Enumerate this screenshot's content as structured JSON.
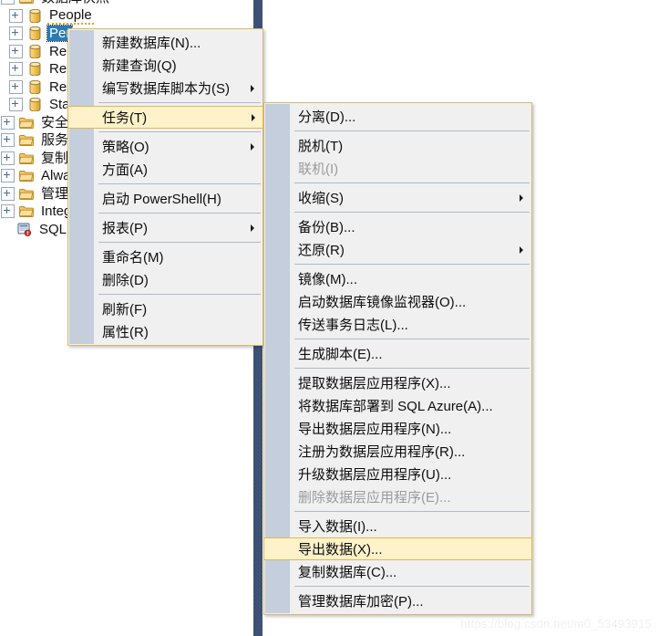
{
  "colors": {
    "menu_bg": "#f0f0f0",
    "menu_border": "#d7b96a",
    "menu_gutter": "#c4cedc",
    "highlight_bg": "#fdf2ca",
    "highlight_border": "#e3b84b",
    "tree_selected_bg": "#2a7ab9",
    "splitter": "#3b4f72",
    "separator": "#b0b9c6",
    "disabled_text": "#9b9b9b",
    "folder_icon": "#f0c05a",
    "database_icon": "#e8b54d"
  },
  "tree": {
    "name": "object-explorer-tree",
    "items": [
      {
        "label": "数据库快照",
        "icon": "folder-icon",
        "expandable": true,
        "indent": 1,
        "clipped_top": true,
        "selected": false
      },
      {
        "label": "People",
        "icon": "database-icon",
        "expandable": true,
        "indent": 2,
        "selected": false,
        "focus_underline": true
      },
      {
        "label": "Per",
        "icon": "database-icon",
        "expandable": true,
        "indent": 2,
        "selected": true
      },
      {
        "label": "Rep",
        "icon": "database-icon",
        "expandable": true,
        "indent": 2,
        "selected": false
      },
      {
        "label": "Rep",
        "icon": "database-icon",
        "expandable": true,
        "indent": 2,
        "selected": false
      },
      {
        "label": "Res",
        "icon": "database-icon",
        "expandable": true,
        "indent": 2,
        "selected": false
      },
      {
        "label": "Sta",
        "icon": "database-icon",
        "expandable": true,
        "indent": 2,
        "selected": false
      },
      {
        "label": "安全性",
        "icon": "folder-icon",
        "expandable": true,
        "indent": 1,
        "selected": false
      },
      {
        "label": "服务器",
        "icon": "folder-icon",
        "expandable": true,
        "indent": 1,
        "selected": false
      },
      {
        "label": "复制",
        "icon": "folder-icon",
        "expandable": true,
        "indent": 1,
        "selected": false
      },
      {
        "label": "Alway",
        "icon": "folder-icon",
        "expandable": true,
        "indent": 1,
        "selected": false
      },
      {
        "label": "管理",
        "icon": "folder-icon",
        "expandable": true,
        "indent": 1,
        "selected": false
      },
      {
        "label": "Integr",
        "icon": "folder-icon",
        "expandable": true,
        "indent": 1,
        "selected": false
      },
      {
        "label": "SQL S",
        "icon": "sql-server-agent-error-icon",
        "expandable": false,
        "indent": 1,
        "selected": false
      }
    ]
  },
  "context_menu_primary": {
    "name": "database-context-menu",
    "items": [
      {
        "label": "新建数据库(N)...",
        "type": "item",
        "submenu": false,
        "disabled": false,
        "highlighted": false
      },
      {
        "label": "新建查询(Q)",
        "type": "item",
        "submenu": false,
        "disabled": false,
        "highlighted": false
      },
      {
        "label": "编写数据库脚本为(S)",
        "type": "item",
        "submenu": true,
        "disabled": false,
        "highlighted": false
      },
      {
        "type": "separator"
      },
      {
        "label": "任务(T)",
        "type": "item",
        "submenu": true,
        "disabled": false,
        "highlighted": true
      },
      {
        "type": "separator"
      },
      {
        "label": "策略(O)",
        "type": "item",
        "submenu": true,
        "disabled": false,
        "highlighted": false
      },
      {
        "label": "方面(A)",
        "type": "item",
        "submenu": false,
        "disabled": false,
        "highlighted": false
      },
      {
        "type": "separator"
      },
      {
        "label": "启动 PowerShell(H)",
        "type": "item",
        "submenu": false,
        "disabled": false,
        "highlighted": false
      },
      {
        "type": "separator"
      },
      {
        "label": "报表(P)",
        "type": "item",
        "submenu": true,
        "disabled": false,
        "highlighted": false
      },
      {
        "type": "separator"
      },
      {
        "label": "重命名(M)",
        "type": "item",
        "submenu": false,
        "disabled": false,
        "highlighted": false
      },
      {
        "label": "删除(D)",
        "type": "item",
        "submenu": false,
        "disabled": false,
        "highlighted": false
      },
      {
        "type": "separator"
      },
      {
        "label": "刷新(F)",
        "type": "item",
        "submenu": false,
        "disabled": false,
        "highlighted": false
      },
      {
        "label": "属性(R)",
        "type": "item",
        "submenu": false,
        "disabled": false,
        "highlighted": false
      }
    ]
  },
  "context_menu_tasks": {
    "name": "tasks-submenu",
    "items": [
      {
        "label": "分离(D)...",
        "type": "item",
        "submenu": false,
        "disabled": false,
        "highlighted": false
      },
      {
        "type": "separator"
      },
      {
        "label": "脱机(T)",
        "type": "item",
        "submenu": false,
        "disabled": false,
        "highlighted": false
      },
      {
        "label": "联机(I)",
        "type": "item",
        "submenu": false,
        "disabled": true,
        "highlighted": false
      },
      {
        "type": "separator"
      },
      {
        "label": "收缩(S)",
        "type": "item",
        "submenu": true,
        "disabled": false,
        "highlighted": false
      },
      {
        "type": "separator"
      },
      {
        "label": "备份(B)...",
        "type": "item",
        "submenu": false,
        "disabled": false,
        "highlighted": false
      },
      {
        "label": "还原(R)",
        "type": "item",
        "submenu": true,
        "disabled": false,
        "highlighted": false
      },
      {
        "type": "separator"
      },
      {
        "label": "镜像(M)...",
        "type": "item",
        "submenu": false,
        "disabled": false,
        "highlighted": false
      },
      {
        "label": "启动数据库镜像监视器(O)...",
        "type": "item",
        "submenu": false,
        "disabled": false,
        "highlighted": false
      },
      {
        "label": "传送事务日志(L)...",
        "type": "item",
        "submenu": false,
        "disabled": false,
        "highlighted": false
      },
      {
        "type": "separator"
      },
      {
        "label": "生成脚本(E)...",
        "type": "item",
        "submenu": false,
        "disabled": false,
        "highlighted": false
      },
      {
        "type": "separator"
      },
      {
        "label": "提取数据层应用程序(X)...",
        "type": "item",
        "submenu": false,
        "disabled": false,
        "highlighted": false
      },
      {
        "label": "将数据库部署到 SQL Azure(A)...",
        "type": "item",
        "submenu": false,
        "disabled": false,
        "highlighted": false
      },
      {
        "label": "导出数据层应用程序(N)...",
        "type": "item",
        "submenu": false,
        "disabled": false,
        "highlighted": false
      },
      {
        "label": "注册为数据层应用程序(R)...",
        "type": "item",
        "submenu": false,
        "disabled": false,
        "highlighted": false
      },
      {
        "label": "升级数据层应用程序(U)...",
        "type": "item",
        "submenu": false,
        "disabled": false,
        "highlighted": false
      },
      {
        "label": "删除数据层应用程序(E)...",
        "type": "item",
        "submenu": false,
        "disabled": true,
        "highlighted": false
      },
      {
        "type": "separator"
      },
      {
        "label": "导入数据(I)...",
        "type": "item",
        "submenu": false,
        "disabled": false,
        "highlighted": false
      },
      {
        "label": "导出数据(X)...",
        "type": "item",
        "submenu": false,
        "disabled": false,
        "highlighted": true
      },
      {
        "label": "复制数据库(C)...",
        "type": "item",
        "submenu": false,
        "disabled": false,
        "highlighted": false
      },
      {
        "type": "separator"
      },
      {
        "label": "管理数据库加密(P)...",
        "type": "item",
        "submenu": false,
        "disabled": false,
        "highlighted": false
      }
    ]
  },
  "watermark": {
    "text": "https://blog.csdn.net/m0_53493915"
  }
}
